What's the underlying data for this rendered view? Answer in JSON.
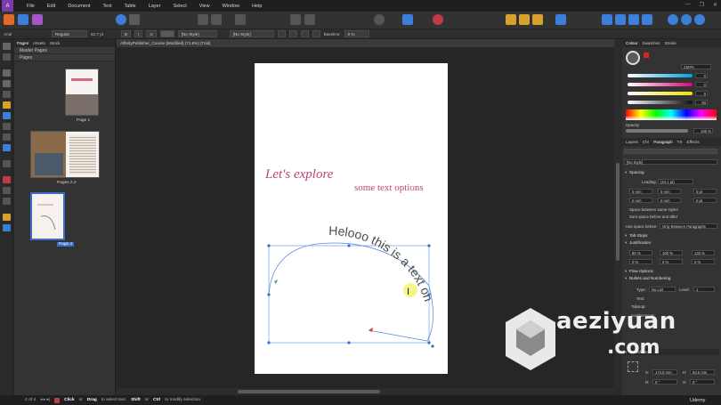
{
  "app": {
    "logo_letter": "A",
    "menus": [
      "File",
      "Edit",
      "Document",
      "Text",
      "Table",
      "Layer",
      "Select",
      "View",
      "Window",
      "Help"
    ],
    "window_controls": [
      "—",
      "❐",
      "✕"
    ]
  },
  "context_toolbar": {
    "font": "Arial",
    "style": "Regular",
    "size": "62.7 pt",
    "bold": "B",
    "italic": "I",
    "underline": "U",
    "char_style": "[No Style]",
    "para_style": "[No Style]",
    "baseline_label": "Baseline:",
    "baseline_value": "0 %"
  },
  "pages_panel": {
    "tabs": [
      "Pages",
      "Assets",
      "Stock"
    ],
    "master_pages": "Master Pages",
    "pages": "Pages",
    "thumbs": [
      {
        "label": "Page 1"
      },
      {
        "label": "Pages 2,3"
      },
      {
        "label": "Page 4"
      }
    ]
  },
  "document": {
    "tab_title": "AffinityPublisher_Course [Modified] (71.6%) [Trial]",
    "headline_script": "Let's explore",
    "headline_sub": "some text options",
    "path_text": "Helooo this is a text on",
    "accent_color": "#c0407a"
  },
  "right_panel": {
    "top_tabs": [
      "Colour",
      "Swatches",
      "Stroke"
    ],
    "color_model": "CMYK",
    "cmyk": [
      "0",
      "0",
      "0",
      "93"
    ],
    "opacity_label": "Opacity",
    "opacity_value": "100 %",
    "para_tabs": [
      "Layers",
      "Chr",
      "Paragraph",
      "TS",
      "Effects"
    ],
    "para_style": "[No Style]",
    "spacing": "Spacing",
    "leading_label": "Leading:",
    "leading_value": "(44.1 pt)",
    "spacing_rows": [
      [
        "0 mm",
        "0 mm",
        "0 pt"
      ],
      [
        "0 mm",
        "0 mm",
        "0 pt"
      ]
    ],
    "space_same_styles": "Space between same styles",
    "sum_space": "Sum space before and after",
    "use_space_before": "Use space before:",
    "use_space_before_value": "Only Between Paragraphs",
    "tab_stops": "Tab Stops",
    "justification": "Justification",
    "just_row1": [
      "80 %",
      "100 %",
      "133 %"
    ],
    "just_row2": [
      "0 %",
      "0 %",
      "0 %"
    ],
    "flow_options": "Flow Options",
    "bullets": "Bullets and Numbering",
    "type_label": "Type:",
    "type_value": "No List",
    "level_label": "Level:",
    "level_value": "1",
    "text_label": "Text:",
    "tabstop_label": "Tabstop:",
    "numbering_at": "numbering at",
    "transform": "Transform",
    "x_label": "X:",
    "x_value": "174.8 mm",
    "h_label": "H:",
    "h_value": "93.5 mm",
    "r_label": "R:",
    "r_value": "0 °",
    "s_label": "S:",
    "s_value": "0 °"
  },
  "status": {
    "page_indicator": "4 of 4",
    "hint_a": "Click",
    "hint_b": "or",
    "hint_c": "Drag",
    "hint_d": "to select text.",
    "hint_e": "Shift",
    "hint_f": "or",
    "hint_g": "Ctrl",
    "hint_h": "to modify selection."
  },
  "watermark": {
    "line1": "aeziyuan",
    "line2": ".com",
    "udemy": "Udemy"
  }
}
